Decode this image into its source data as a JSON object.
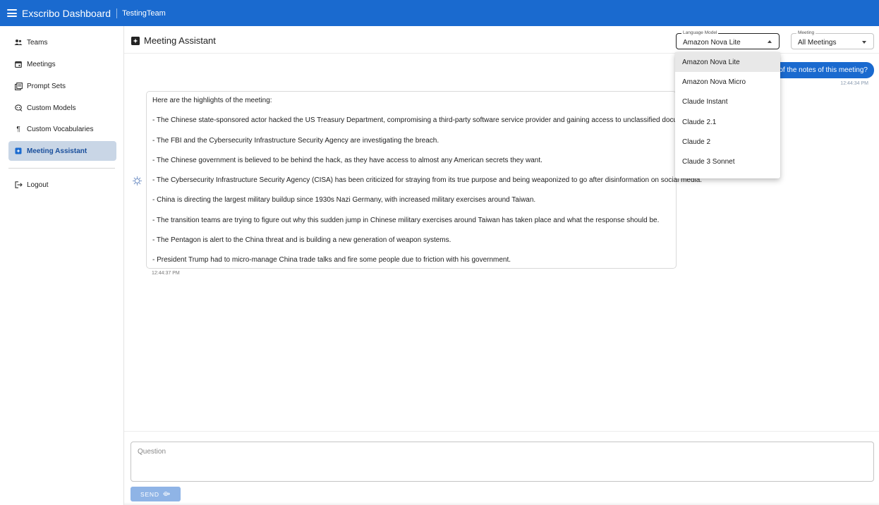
{
  "app": {
    "title": "Exscribo Dashboard",
    "team": "TestingTeam",
    "accent_color": "#1a6acf"
  },
  "sidebar": {
    "items": [
      {
        "label": "Teams",
        "icon": "people-icon"
      },
      {
        "label": "Meetings",
        "icon": "calendar-icon"
      },
      {
        "label": "Prompt Sets",
        "icon": "library-icon"
      },
      {
        "label": "Custom Models",
        "icon": "model-icon"
      },
      {
        "label": "Custom Vocabularies",
        "icon": "pilcrow-icon"
      },
      {
        "label": "Meeting Assistant",
        "icon": "assistant-icon",
        "active": true
      }
    ],
    "logout_label": "Logout"
  },
  "header": {
    "title": "Meeting Assistant",
    "model_select": {
      "label": "Language Model",
      "value": "Amazon Nova Lite"
    },
    "meeting_select": {
      "label": "Meeting",
      "value": "All Meetings"
    }
  },
  "model_options": [
    "Amazon Nova Lite",
    "Amazon Nova Micro",
    "Claude Instant",
    "Claude 2.1",
    "Claude 2",
    "Claude 3 Sonnet"
  ],
  "chat": {
    "user_message": "s of the notes of this meeting?",
    "user_time": "12:44:34 PM",
    "bot_lines": [
      "Here are the highlights of the meeting:",
      "- The Chinese state-sponsored actor hacked the US Treasury Department, compromising a third-party software service provider and gaining access to unclassified documents.",
      "- The FBI and the Cybersecurity Infrastructure Security Agency are investigating the breach.",
      "- The Chinese government is believed to be behind the hack, as they have access to almost any American secrets they want.",
      "- The Cybersecurity Infrastructure Security Agency (CISA) has been criticized for straying from its true purpose and being weaponized to go after disinformation on social media.",
      "- China is directing the largest military buildup since 1930s Nazi Germany, with increased military exercises around Taiwan.",
      "- The transition teams are trying to figure out why this sudden jump in Chinese military exercises around Taiwan has taken place and what the response should be.",
      "- The Pentagon is alert to the China threat and is building a new generation of weapon systems.",
      "- President Trump had to micro-manage China trade talks and fire some people due to friction with his government."
    ],
    "bot_time": "12:44:37 PM"
  },
  "input": {
    "placeholder": "Question",
    "value": "",
    "send_label": "SEND"
  }
}
